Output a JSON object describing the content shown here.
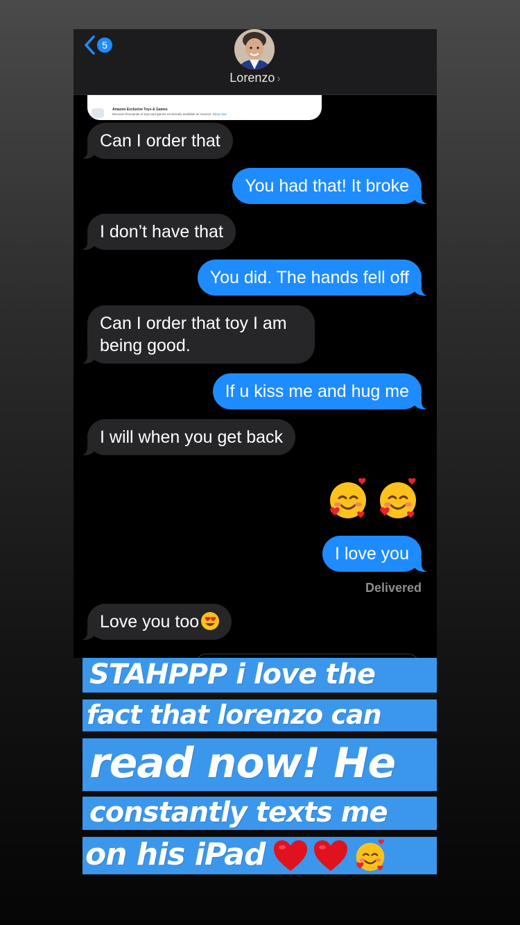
{
  "header": {
    "back_count": "5",
    "contact_name": "Lorenzo",
    "chevron": "›"
  },
  "link_preview": {
    "title": "Amazon Exclusive Toys & Games",
    "description": "Discover thousands of toys and games exclusively available at Amazon.",
    "cta": "Shop now"
  },
  "messages": [
    {
      "side": "received",
      "text": "Can I order that"
    },
    {
      "side": "sent",
      "text": "You had that! It broke"
    },
    {
      "side": "received",
      "text": "I don’t have that"
    },
    {
      "side": "sent",
      "text": "You did. The hands fell off"
    },
    {
      "side": "received",
      "text": "Can I order that toy I am being good."
    },
    {
      "side": "sent",
      "text": "If u kiss me and hug me"
    },
    {
      "side": "received",
      "text": "I will when you get back"
    },
    {
      "side": "sent",
      "text": "I love you"
    },
    {
      "side": "received",
      "text": "Love you too"
    }
  ],
  "emoji_message": [
    "smiling-face-with-hearts",
    "smiling-face-with-hearts"
  ],
  "delivered_label": "Delivered",
  "caption": {
    "lines": [
      "STAHPPP i love the",
      "fact that lorenzo can",
      "read now! He",
      "constantly texts me",
      "on his iPad"
    ],
    "trailing_emoji": [
      "red-heart",
      "red-heart",
      "smiling-face-with-hearts"
    ]
  },
  "colors": {
    "sent_bubble": "#1e8cff",
    "received_bubble": "#262629",
    "caption_highlight": "#3b97ec"
  }
}
